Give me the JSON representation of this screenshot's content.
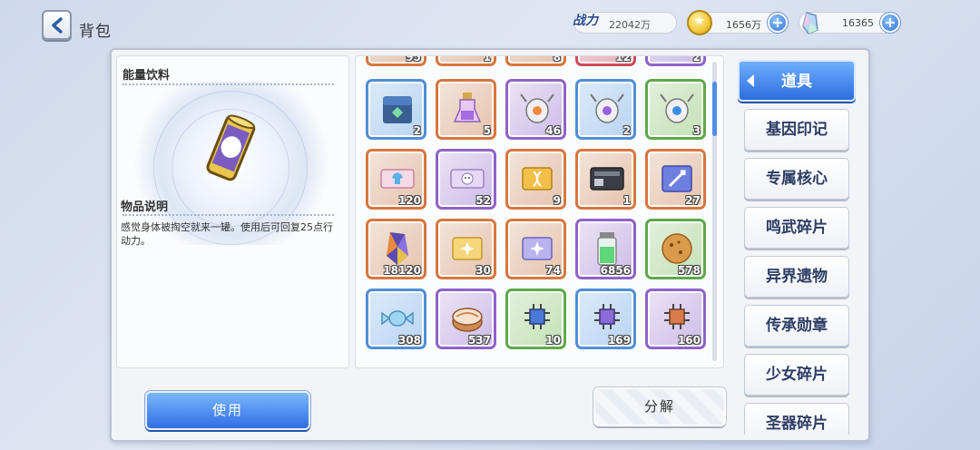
{
  "header": {
    "title": "背包",
    "power_label": "战力",
    "power_value": "22042万",
    "coins": "1656万",
    "gems": "16365"
  },
  "detail": {
    "item_name": "能量饮料",
    "desc_title": "物品说明",
    "desc_text": "感觉身体被掏空就来一罐。使用后可回复25点行动力。"
  },
  "grid": {
    "top_partial_counts": [
      "95",
      "1",
      "8",
      "12",
      "2"
    ],
    "rows": [
      [
        {
          "icon": "blue-lockbox-icon",
          "rarity": "blue",
          "count": "2"
        },
        {
          "icon": "purple-potion-bottle-icon",
          "rarity": "orange",
          "count": "5"
        },
        {
          "icon": "orange-drone-icon",
          "rarity": "purple",
          "count": "46"
        },
        {
          "icon": "purple-drone-icon",
          "rarity": "blue",
          "count": "2"
        },
        {
          "icon": "blue-drone-icon",
          "rarity": "green",
          "count": "3"
        }
      ],
      [
        {
          "icon": "shirt-ticket-icon",
          "rarity": "orange",
          "count": "120"
        },
        {
          "icon": "smiley-ticket-icon",
          "rarity": "purple",
          "count": "52"
        },
        {
          "icon": "dna-card-icon",
          "rarity": "orange",
          "count": "9"
        },
        {
          "icon": "id-card-device-icon",
          "rarity": "orange",
          "count": "1"
        },
        {
          "icon": "sword-card-icon",
          "rarity": "orange",
          "count": "27"
        }
      ],
      [
        {
          "icon": "rainbow-crystal-icon",
          "rarity": "orange",
          "count": "18120"
        },
        {
          "icon": "gold-star-card-icon",
          "rarity": "orange",
          "count": "30"
        },
        {
          "icon": "rainbow-star-card-icon",
          "rarity": "orange",
          "count": "74"
        },
        {
          "icon": "green-battery-icon",
          "rarity": "purple",
          "count": "6856"
        },
        {
          "icon": "cookie-icon",
          "rarity": "green",
          "count": "578"
        }
      ],
      [
        {
          "icon": "candy-icon",
          "rarity": "blue",
          "count": "308"
        },
        {
          "icon": "cake-roll-icon",
          "rarity": "purple",
          "count": "537"
        },
        {
          "icon": "blue-chip-icon",
          "rarity": "green",
          "count": "10"
        },
        {
          "icon": "purple-chip-icon",
          "rarity": "blue",
          "count": "169"
        },
        {
          "icon": "orange-chip-icon",
          "rarity": "purple",
          "count": "160"
        }
      ]
    ]
  },
  "tabs": [
    "道具",
    "基因印记",
    "专属核心",
    "鸣武碎片",
    "异界遗物",
    "传承勋章",
    "少女碎片",
    "圣器碎片"
  ],
  "buttons": {
    "use": "使用",
    "decompose": "分解"
  }
}
